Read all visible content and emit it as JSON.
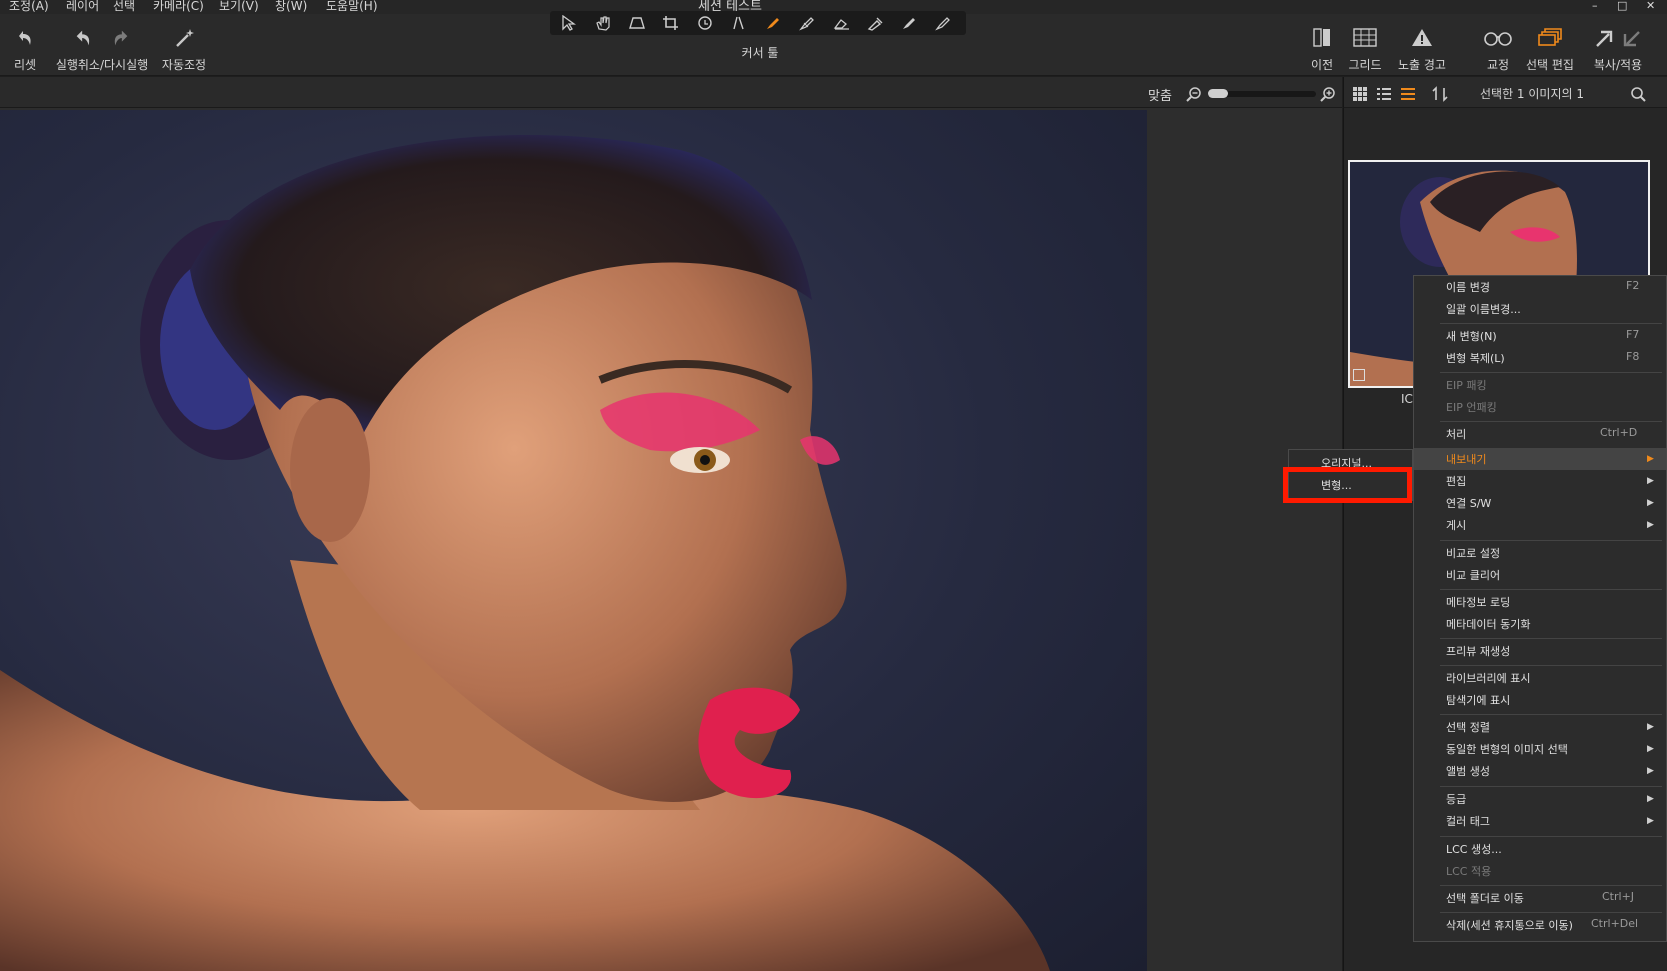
{
  "window": {
    "title": "세션 테스트",
    "controls": [
      "–",
      "□",
      "✕"
    ]
  },
  "menubar": [
    "조정(A)",
    "레이어",
    "선택",
    "카메라(C)",
    "보기(V)",
    "창(W)",
    "도움말(H)"
  ],
  "toolbar": {
    "reset": "리셋",
    "undo_redo": "실행취소/다시실행",
    "auto_adjust": "자동조정",
    "cursor_tools": "커서 툴",
    "before": "이전",
    "grid": "그리드",
    "exposure_warning": "노출 경고",
    "proof": "교정",
    "edit_selected": "선택 편집",
    "copy_apply": "복사/적용",
    "accent_color": "#f08a1c"
  },
  "viewer": {
    "fit_label": "맞춤"
  },
  "browser": {
    "selection_count": "선택한 1 이미지의 1",
    "thumbnail_name": "IC"
  },
  "context_menu": {
    "items": [
      {
        "label": "이름 변경",
        "shortcut": "F2"
      },
      {
        "label": "일괄 이름변경..."
      },
      {
        "label": "새 변형(N)",
        "shortcut": "F7"
      },
      {
        "label": "변형 복제(L)",
        "shortcut": "F8"
      },
      {
        "label": "EIP 패킹",
        "disabled": true
      },
      {
        "label": "EIP 언패킹",
        "disabled": true
      },
      {
        "label": "처리",
        "shortcut": "Ctrl+D"
      },
      {
        "label": "내보내기",
        "submenu": true,
        "highlighted": true
      },
      {
        "label": "편집",
        "submenu": true
      },
      {
        "label": "연결 S/W",
        "submenu": true
      },
      {
        "label": "게시",
        "submenu": true
      },
      {
        "label": "비교로 설정"
      },
      {
        "label": "비교 클리어"
      },
      {
        "label": "메타정보 로딩"
      },
      {
        "label": "메타데이터 동기화"
      },
      {
        "label": "프리뷰 재생성"
      },
      {
        "label": "라이브러리에 표시"
      },
      {
        "label": "탐색기에 표시"
      },
      {
        "label": "선택 정렬",
        "submenu": true
      },
      {
        "label": "동일한 변형의 이미지 선택",
        "submenu": true
      },
      {
        "label": "앨범 생성",
        "submenu": true
      },
      {
        "label": "등급",
        "submenu": true
      },
      {
        "label": "컬러 태그",
        "submenu": true
      },
      {
        "label": "LCC 생성..."
      },
      {
        "label": "LCC 적용",
        "disabled": true
      },
      {
        "label": "선택 폴더로 이동",
        "shortcut": "Ctrl+J"
      },
      {
        "label": "삭제(세션 휴지통으로 이동)",
        "shortcut": "Ctrl+Del"
      }
    ]
  },
  "export_submenu": {
    "original": "오리지널...",
    "variant": "변형..."
  }
}
